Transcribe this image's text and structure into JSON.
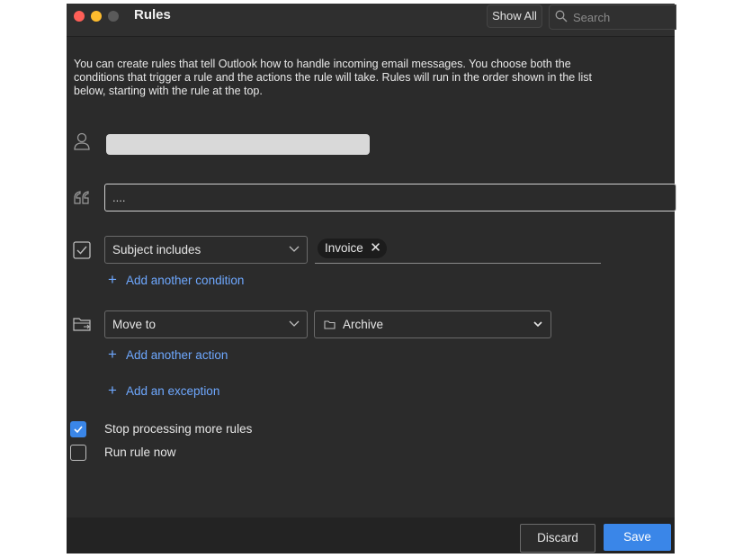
{
  "window": {
    "title": "Rules"
  },
  "toolbar": {
    "show_all_label": "Show All",
    "search_placeholder": "Search"
  },
  "intro_text": "You can create rules that tell Outlook how to handle incoming email messages. You choose both the conditions that trigger a rule and the actions the rule will take. Rules will run in the order shown in the list below, starting with the rule at the top.",
  "rule": {
    "name_value": "....",
    "condition": {
      "type": "Subject includes",
      "token": "Invoice"
    },
    "add_condition_label": "Add another condition",
    "action": {
      "type": "Move to",
      "folder": "Archive"
    },
    "add_action_label": "Add another action",
    "add_exception_label": "Add an exception"
  },
  "options": [
    {
      "label": "Stop processing more rules",
      "checked": true
    },
    {
      "label": "Run rule now",
      "checked": false
    }
  ],
  "footer": {
    "discard_label": "Discard",
    "save_label": "Save"
  },
  "colors": {
    "accent": "#3a86e8",
    "link": "#6ea8ff",
    "background": "#2b2b2b"
  }
}
